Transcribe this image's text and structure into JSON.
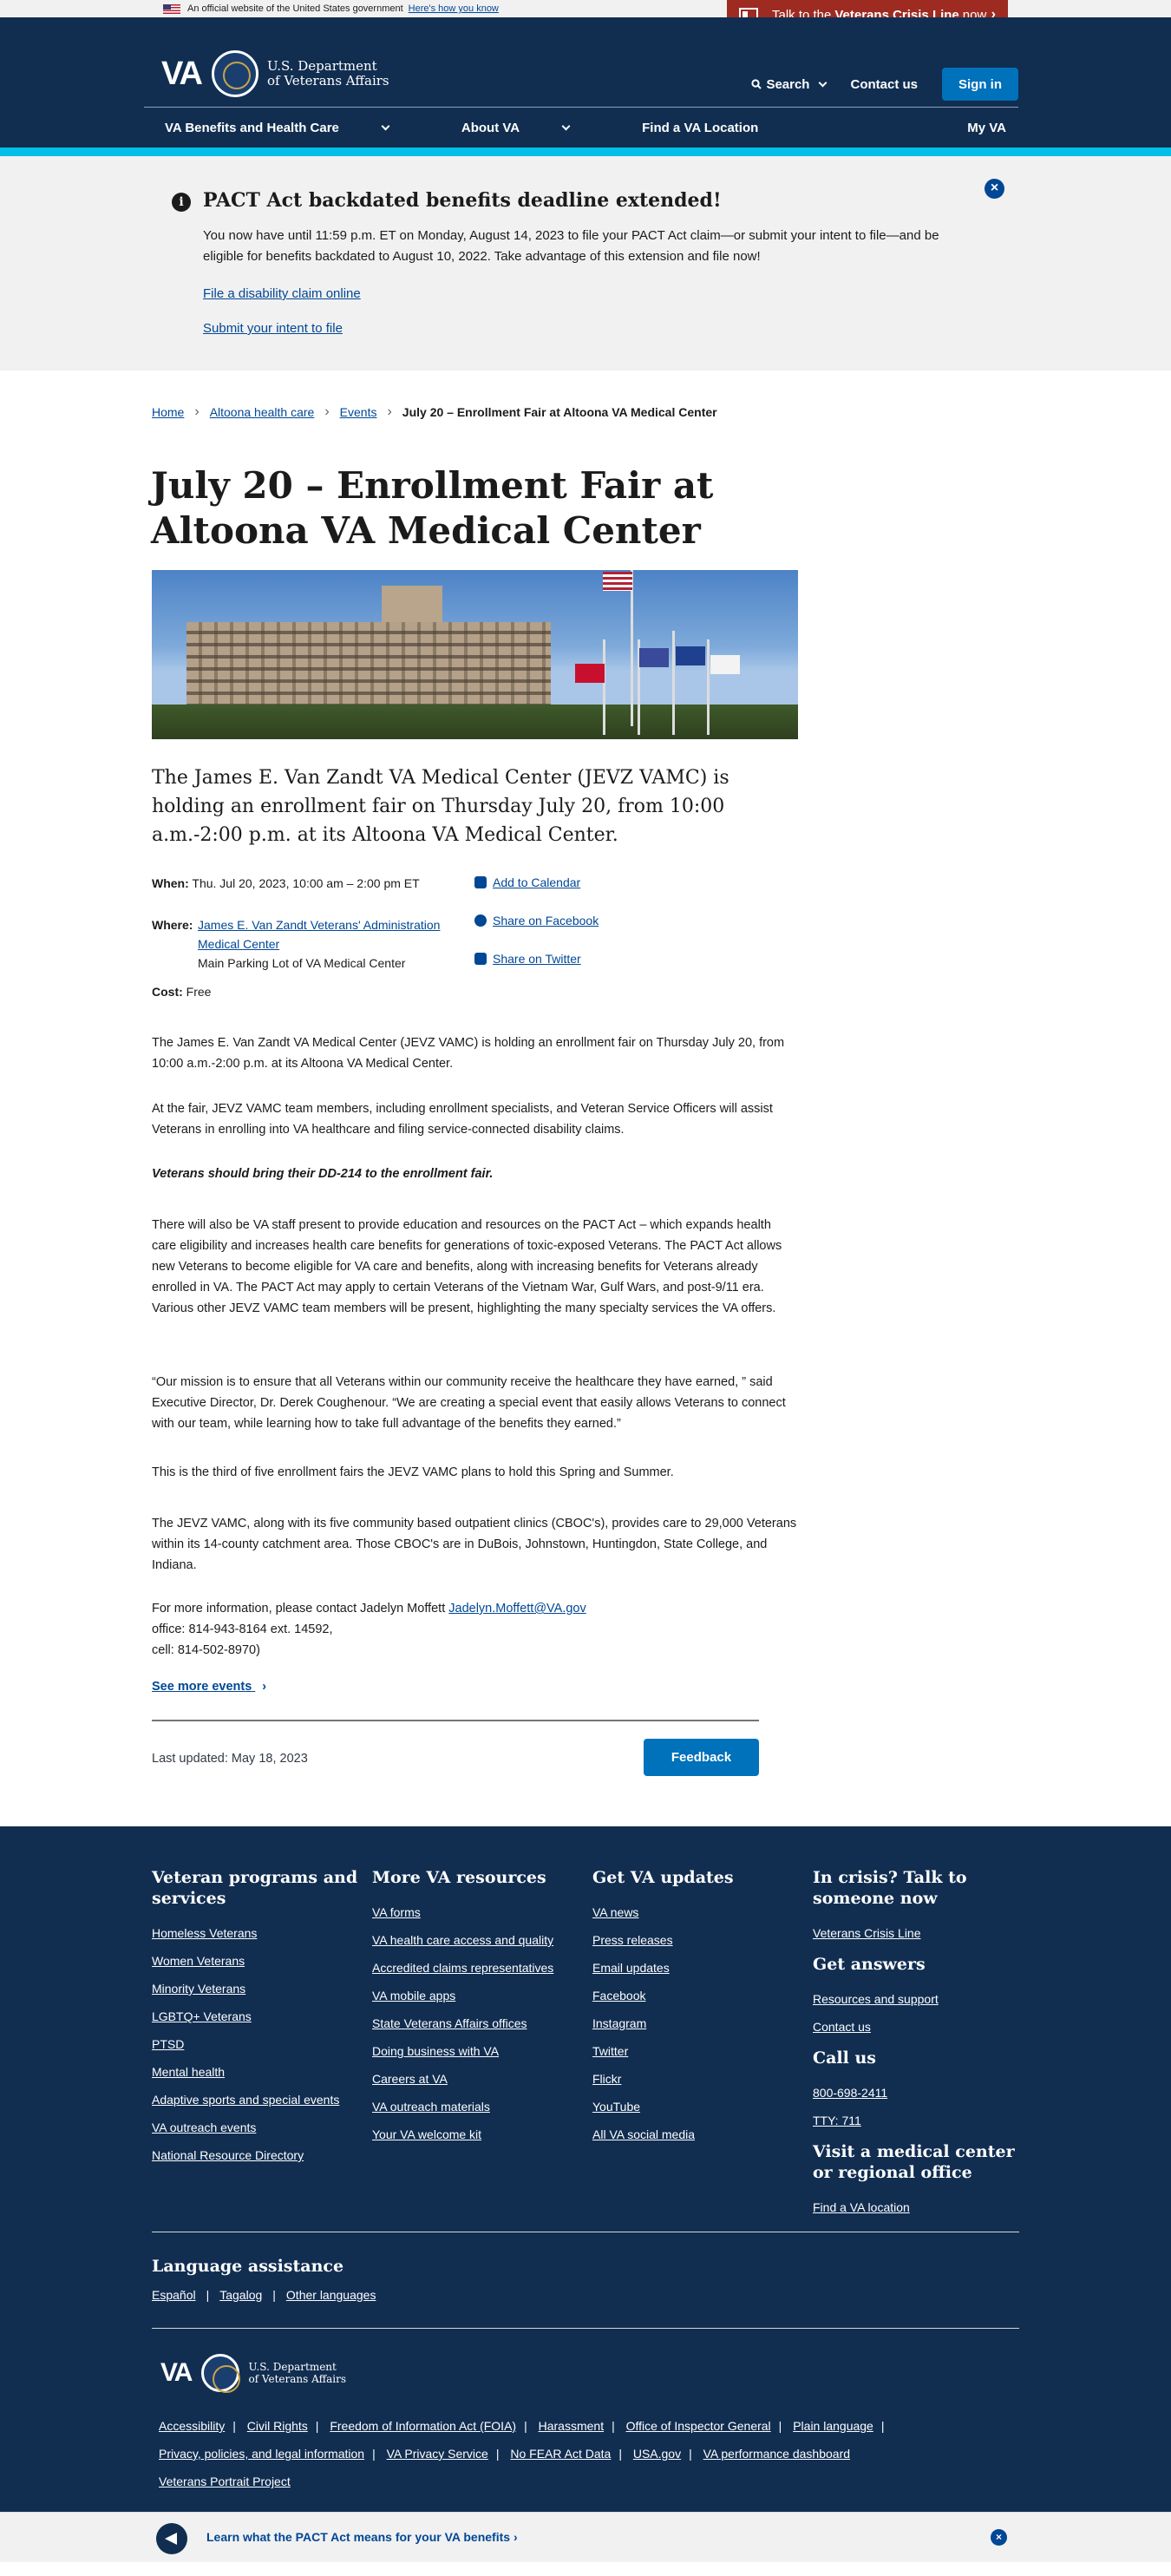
{
  "gov_banner": {
    "text": "An official website of the United States government",
    "how_link": "Here's how you know"
  },
  "crisis_line": {
    "prefix": "Talk to the",
    "bold": "Veterans Crisis Line",
    "suffix": "now"
  },
  "header": {
    "logo_text": "VA",
    "dept_line1": "U.S. Department",
    "dept_line2": "of Veterans Affairs",
    "search_label": "Search",
    "contact_label": "Contact us",
    "signin_label": "Sign in"
  },
  "nav": {
    "items": [
      "VA Benefits and Health Care",
      "About VA",
      "Find a VA Location"
    ],
    "my_va": "My VA"
  },
  "alert": {
    "title": "PACT Act backdated benefits deadline extended!",
    "body": "You now have until 11:59 p.m. ET on Monday, August 14, 2023 to file your PACT Act claim—or submit your intent to file—and be eligible for benefits backdated to August 10, 2022. Take advantage of this extension and file now!",
    "link1": "File a disability claim online",
    "link2": "Submit your intent to file"
  },
  "breadcrumb": {
    "items": [
      "Home",
      "Altoona health care",
      "Events"
    ],
    "current": "July 20 – Enrollment Fair at Altoona VA Medical Center"
  },
  "page": {
    "title": "July 20 – Enrollment Fair at Altoona VA Medical Center",
    "lead": "The James E. Van Zandt VA Medical Center (JEVZ VAMC) is holding an enrollment fair on Thursday July 20, from 10:00 a.m.-2:00 p.m. at its Altoona VA Medical Center.",
    "when_label": "When:",
    "when_value": "Thu. Jul 20, 2023, 10:00 am – 2:00 pm ET",
    "where_label": "Where:",
    "where_link_line1": "James E. Van Zandt Veterans' Administration",
    "where_link_line2": "Medical Center",
    "where_detail": "Main Parking Lot of VA Medical Center",
    "cost_label": "Cost:",
    "cost_value": "Free",
    "add_calendar": "Add to Calendar",
    "share_facebook": "Share on Facebook",
    "share_twitter": "Share on Twitter",
    "p1": "The James E. Van Zandt VA Medical Center (JEVZ VAMC) is holding an enrollment fair on Thursday July 20, from 10:00 a.m.-2:00 p.m. at its Altoona VA Medical Center.",
    "p2": "At the fair, JEVZ VAMC team members, including enrollment specialists, and Veteran Service Officers will assist Veterans in enrolling into VA healthcare and filing service-connected disability claims.",
    "p3": "Veterans should bring their DD-214 to the enrollment fair.",
    "p4": "There will also be VA staff present to provide education and resources on the PACT Act – which expands health care eligibility and increases health care benefits for generations of toxic-exposed Veterans. The PACT Act allows new Veterans to become eligible for VA care and benefits, along with increasing benefits for Veterans already enrolled in VA. The PACT Act may apply to certain Veterans of the Vietnam War, Gulf Wars, and post-9/11 era. Various other JEVZ VAMC team members will be present, highlighting the many specialty services the VA offers.",
    "p5": "“Our mission is to ensure that all Veterans within our community receive the healthcare they have earned, ” said Executive Director, Dr. Derek Coughenour. “We are creating a special event that easily allows Veterans to connect with our team, while learning how to take full advantage of the benefits they earned.”",
    "p6": "This is the third of five enrollment fairs the JEVZ VAMC plans to hold this Spring and Summer.",
    "p7": "The JEVZ VAMC, along with its five community based outpatient clinics (CBOC's), provides care to 29,000 Veterans within its 14-county catchment area. Those CBOC's are in DuBois, Johnstown, Huntingdon, State College, and Indiana.",
    "contact_text": "For more information, please contact Jadelyn Moffett",
    "contact_email": "Jadelyn.Moffett@VA.gov",
    "contact_office": "office: 814-943-8164 ext. 14592,",
    "contact_cell": "cell: 814-502-8970)",
    "see_more": "See more events",
    "last_updated": "Last updated: May 18, 2023",
    "feedback": "Feedback"
  },
  "footer": {
    "col1": {
      "title": "Veteran programs and services",
      "links": [
        "Homeless Veterans",
        "Women Veterans",
        "Minority Veterans",
        "LGBTQ+ Veterans",
        "PTSD",
        "Mental health",
        "Adaptive sports and special events",
        "VA outreach events",
        "National Resource Directory"
      ]
    },
    "col2": {
      "title": "More VA resources",
      "links": [
        "VA forms",
        "VA health care access and quality",
        "Accredited claims representatives",
        "VA mobile apps",
        "State Veterans Affairs offices",
        "Doing business with VA",
        "Careers at VA",
        "VA outreach materials",
        "Your VA welcome kit"
      ]
    },
    "col3": {
      "title": "Get VA updates",
      "links": [
        "VA news",
        "Press releases",
        "Email updates",
        "Facebook",
        "Instagram",
        "Twitter",
        "Flickr",
        "YouTube",
        "All VA social media"
      ]
    },
    "col4": {
      "crisis_title": "In crisis? Talk to someone now",
      "crisis_link": "Veterans Crisis Line",
      "answers_title": "Get answers",
      "answers_links": [
        "Resources and support",
        "Contact us"
      ],
      "call_title": "Call us",
      "call_links": [
        "800-698-2411",
        "TTY: 711"
      ],
      "visit_title": "Visit a medical center or regional office",
      "visit_link": "Find a VA location"
    },
    "language": {
      "title": "Language assistance",
      "links": [
        "Español",
        "Tagalog",
        "Other languages"
      ]
    },
    "bottom_links": [
      "Accessibility",
      "Civil Rights",
      "Freedom of Information Act (FOIA)",
      "Harassment",
      "Office of Inspector General",
      "Plain language",
      "Privacy, policies, and legal information",
      "VA Privacy Service",
      "No FEAR Act Data",
      "USA.gov",
      "VA performance dashboard",
      "Veterans Portrait Project"
    ]
  },
  "bottom_banner": {
    "text": "Learn what the PACT Act means for your VA benefits"
  }
}
